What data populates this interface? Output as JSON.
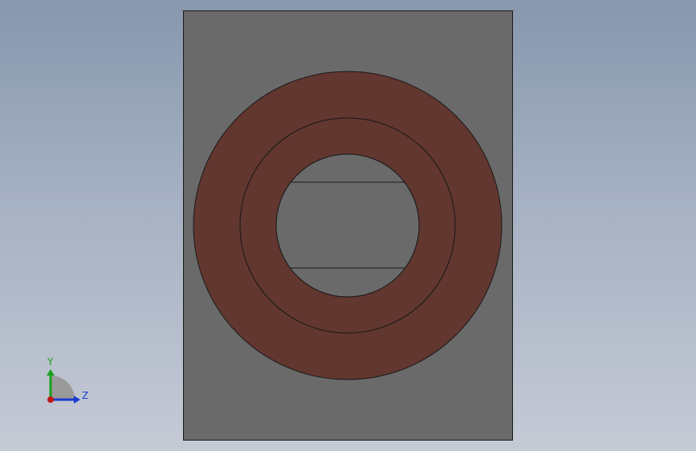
{
  "viewport": {
    "background_top": "#8797ad",
    "background_bottom": "#c5cad5",
    "block_color": "#6a6a6a",
    "ring_color": "#62372f",
    "edge_color": "#1a1a1a"
  },
  "triad": {
    "y_label": "Y",
    "z_label": "Z",
    "y_color": "#1aa01a",
    "z_color": "#1a3ad0",
    "x_color": "#c01818"
  }
}
